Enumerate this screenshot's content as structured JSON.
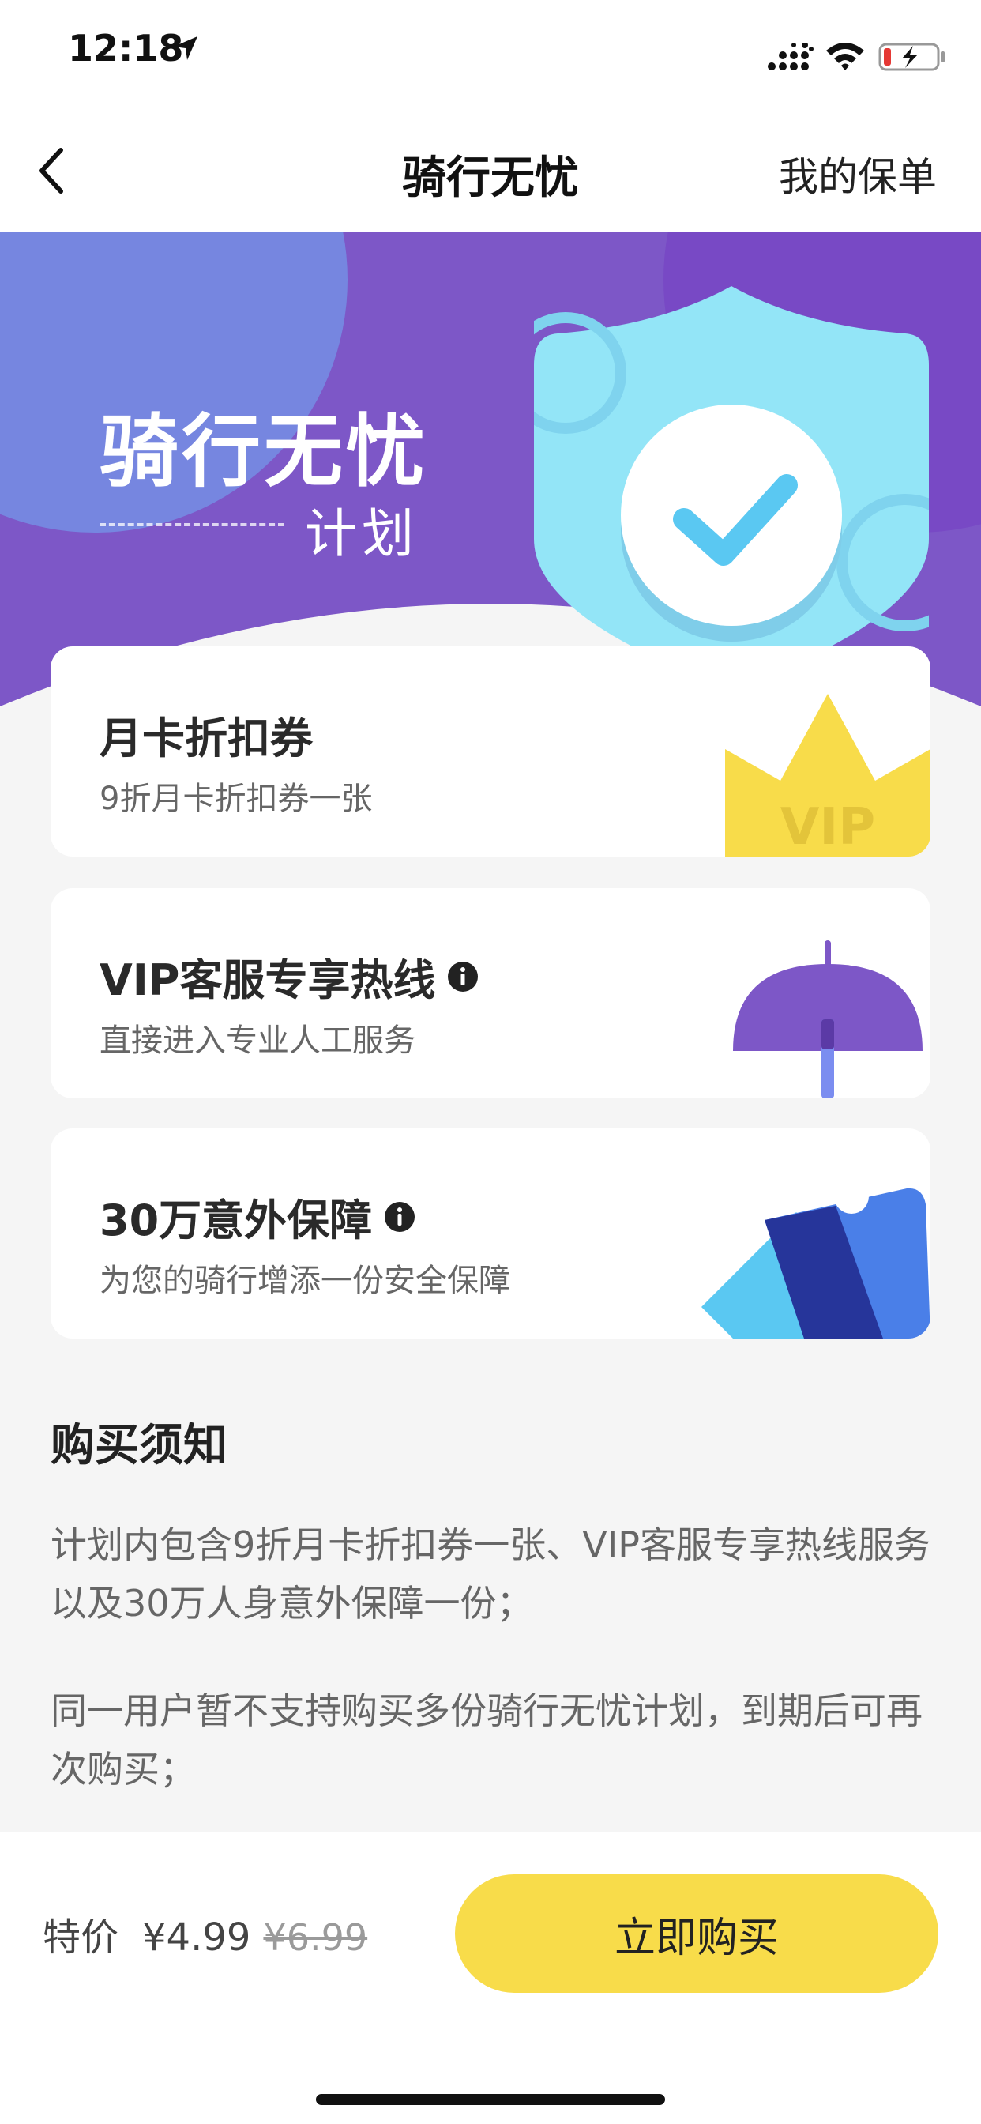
{
  "status_bar": {
    "time": "12:18",
    "icons": [
      "location-arrow-icon",
      "signal-icon",
      "wifi-icon",
      "battery-charging-icon"
    ]
  },
  "nav": {
    "back_icon": "chevron-left-icon",
    "title": "骑行无忧",
    "right_link": "我的保单"
  },
  "hero": {
    "title": "骑行无忧",
    "subtitle": "计划",
    "icon": "shield-check-icon",
    "colors": {
      "purple": "#7d57c7",
      "light_blue": "#93e5f7",
      "accent_blue": "#5ac8f2"
    }
  },
  "benefits": [
    {
      "title": "月卡折扣券",
      "desc": "9折月卡折扣券一张",
      "art": "vip-crown-icon",
      "art_text": "VIP",
      "has_info": false
    },
    {
      "title": "VIP客服专享热线",
      "desc": "直接进入专业人工服务",
      "art": "umbrella-icon",
      "has_info": true
    },
    {
      "title": "30万意外保障",
      "desc": "为您的骑行增添一份安全保障",
      "art": "tickets-icon",
      "has_info": true
    }
  ],
  "notice": {
    "title": "购买须知",
    "items": [
      "计划内包含9折月卡折扣券一张、VIP客服专享热线服务以及30万人身意外保障一份；",
      "同一用户暂不支持购买多份骑行无忧计划，到期后可再次购买；"
    ]
  },
  "purchase": {
    "price_label": "特价",
    "price_now": "¥4.99",
    "price_original": "¥6.99",
    "buy_label": "立即购买",
    "button_color": "#f8dc4a"
  }
}
